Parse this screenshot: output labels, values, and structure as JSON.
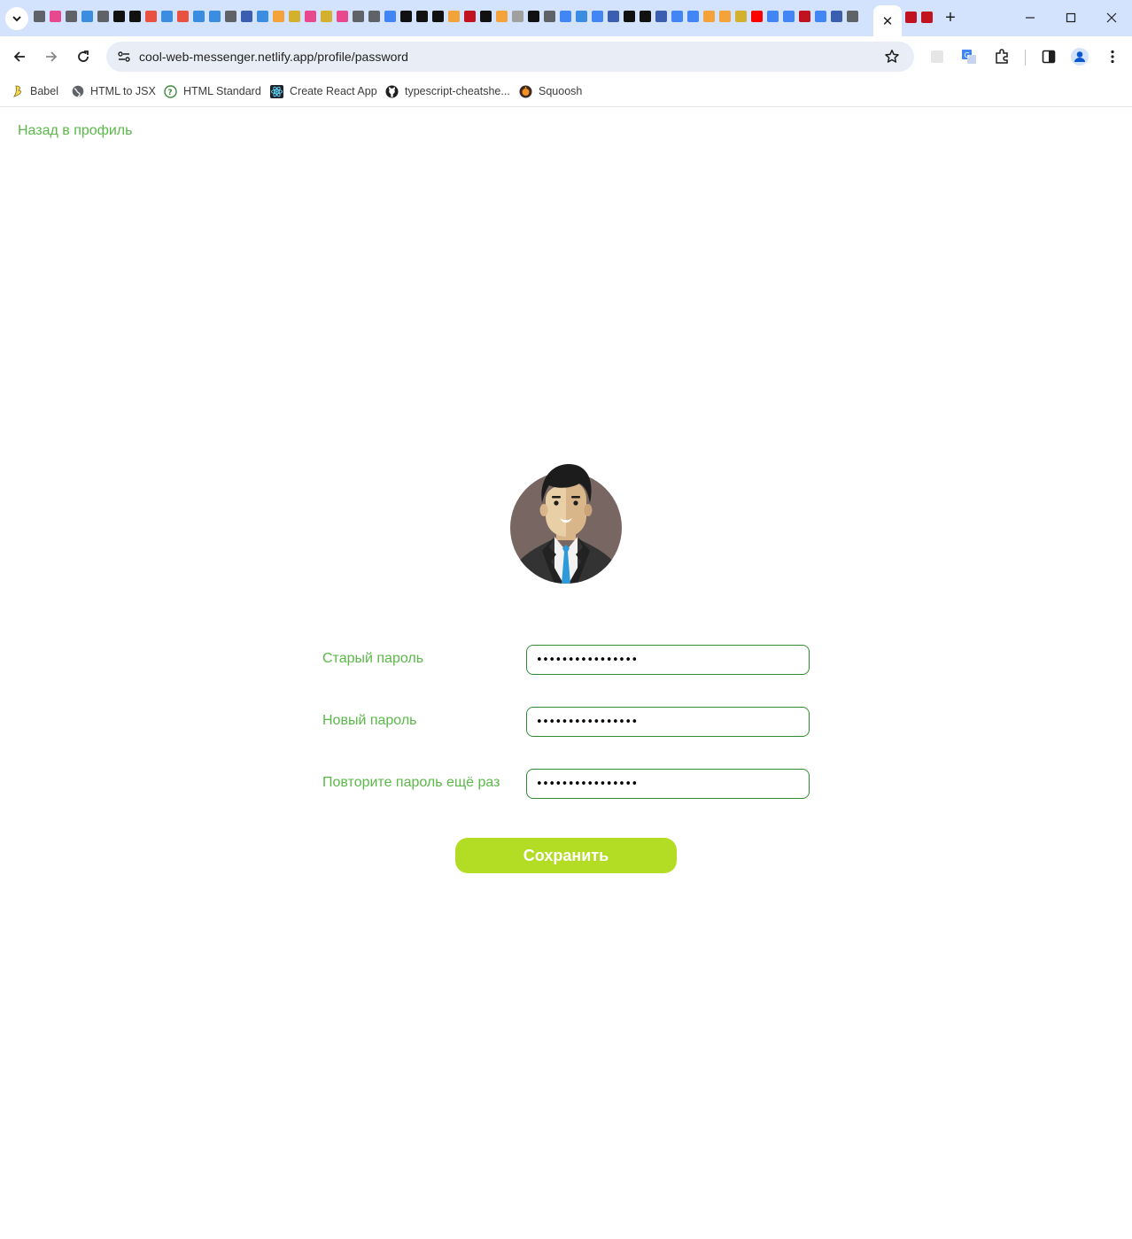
{
  "browser": {
    "active_tab_close": "✕",
    "new_tab": "+",
    "url": "cool-web-messenger.netlify.app/profile/password",
    "favicon_colors": [
      "#5f6368",
      "#e8488e",
      "#5f6368",
      "#3a8de0",
      "#5f6368",
      "#111111",
      "#111111",
      "#e8523f",
      "#3a8de0",
      "#e8523f",
      "#3a8de0",
      "#3a8de0",
      "#5f6368",
      "#3a5fb0",
      "#3a8de0",
      "#f4a23a",
      "#d4b02f",
      "#e8488e",
      "#d4b02f",
      "#e8488e",
      "#5f6368",
      "#5f6368",
      "#4285f4",
      "#111111",
      "#111111",
      "#111111",
      "#f4a23a",
      "#c1121f",
      "#111111",
      "#f4a23a",
      "#a0a0a0",
      "#111111",
      "#5f6368",
      "#4285f4",
      "#3a8de0",
      "#4285f4",
      "#3a5fb0",
      "#111111",
      "#111111",
      "#3a5fb0",
      "#4285f4",
      "#4285f4",
      "#f4a23a",
      "#f4a23a",
      "#d4b02f",
      "#ff0000",
      "#4285f4",
      "#4285f4",
      "#c1121f",
      "#4285f4",
      "#3a5fb0",
      "#5f6368"
    ]
  },
  "bookmarks": [
    {
      "label": "Babel",
      "icon": "babel-icon"
    },
    {
      "label": "HTML to JSX",
      "icon": "globe-icon"
    },
    {
      "label": "HTML Standard",
      "icon": "question-icon"
    },
    {
      "label": "Create React App",
      "icon": "react-icon"
    },
    {
      "label": "typescript-cheatshe...",
      "icon": "github-icon"
    },
    {
      "label": "Squoosh",
      "icon": "squoosh-icon"
    }
  ],
  "page": {
    "back_link": "Назад в профиль",
    "fields": [
      {
        "label": "Старый пароль",
        "value": "••••••••••••••••"
      },
      {
        "label": "Новый пароль",
        "value": "••••••••••••••••"
      },
      {
        "label": "Повторите пароль ещё раз",
        "value": "••••••••••••••••"
      }
    ],
    "save_button": "Сохранить"
  },
  "colors": {
    "accent_text": "#5ab948",
    "button": "#b2dd24",
    "input_border": "#2e8b2e"
  }
}
